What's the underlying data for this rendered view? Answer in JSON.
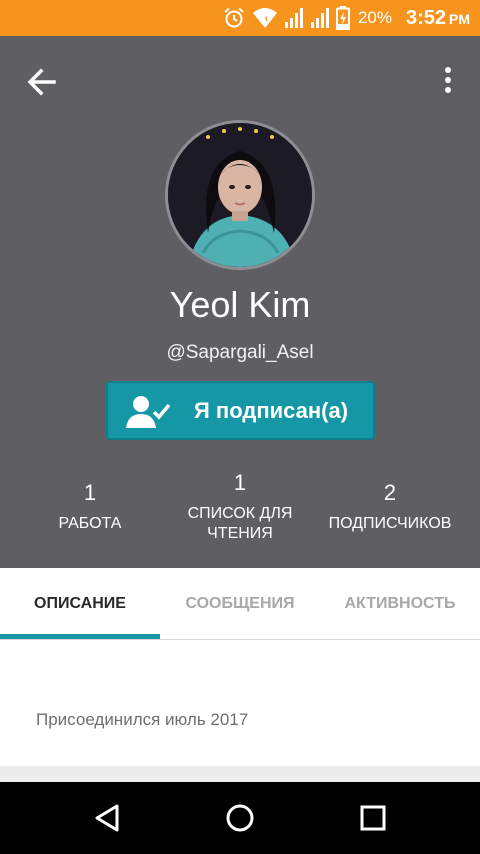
{
  "status_bar": {
    "battery_percent": "20%",
    "time": "3:52",
    "ampm": "PM",
    "background": "#f7941d",
    "icons": [
      "alarm-icon",
      "wifi-icon",
      "signal-icon",
      "signal-icon",
      "battery-charging-icon"
    ]
  },
  "profile": {
    "display_name": "Yeol Kim",
    "username": "@Sapargali_Asel",
    "follow_button_label": "Я подписан(а)",
    "follow_button_color": "#1597a6",
    "header_color": "#5f5e62"
  },
  "stats": [
    {
      "value": "1",
      "label": "РАБОТА"
    },
    {
      "value": "1",
      "label_line1": "СПИСОК ДЛЯ",
      "label_line2": "ЧТЕНИЯ"
    },
    {
      "value": "2",
      "label": "ПОДПИСЧИКОВ"
    }
  ],
  "tabs": [
    {
      "label": "ОПИСАНИЕ",
      "active": true
    },
    {
      "label": "СООБЩЕНИЯ",
      "active": false
    },
    {
      "label": "АКТИВНОСТЬ",
      "active": false
    }
  ],
  "about": {
    "joined": "Присоединился июль 2017"
  }
}
